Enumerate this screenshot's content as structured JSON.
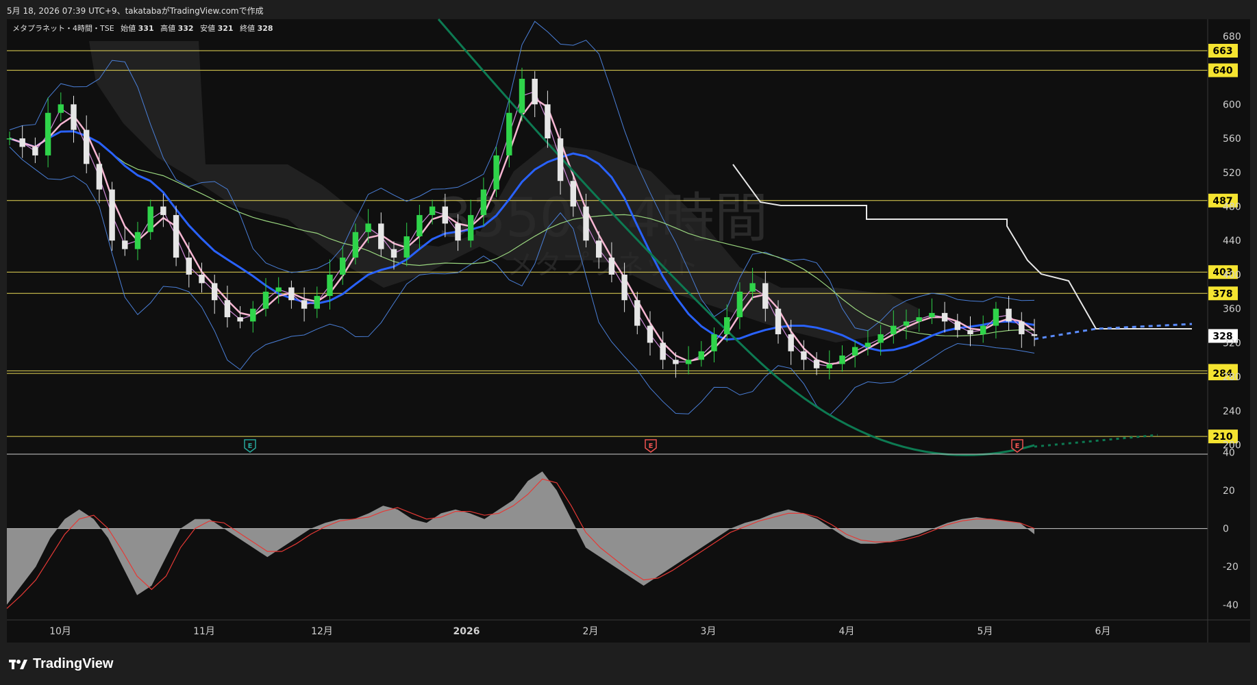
{
  "header": {
    "text": "5月 18, 2026 07:39 UTC+9、takatabaがTradingView.comで作成"
  },
  "legend": {
    "symbol": "メタプラネット・4時間・TSE",
    "open_label": "始値",
    "open": "331",
    "high_label": "高値",
    "high": "332",
    "low_label": "安値",
    "low": "321",
    "close_label": "終値",
    "close": "328"
  },
  "watermark": {
    "ticker": "3350、4時間",
    "name": "メタプラネット"
  },
  "footer": {
    "logo_text": "TradingView"
  },
  "colors": {
    "background": "#0f0f0f",
    "panel": "#1e1e1e",
    "level_line": "#e9d956",
    "level_badge": "#f5e430",
    "up": "#2fd44a",
    "down": "#e6e6e6",
    "ma_fast": "#f7b6d2",
    "ma_mid": "#d08ad8",
    "ma_slow": "#2962ff",
    "bollinger": "#4a7fd8",
    "long_ma": "#9ad67f",
    "trend": "#0d7a52",
    "lagging": "#e8e8e8",
    "macd_fill": "#9e9e9e",
    "macd_signal": "#e53935",
    "earnings_green": "#26a69a",
    "earnings_red": "#ef5350"
  },
  "icons": [
    "tradingview-logo-icon",
    "earnings-e-icon"
  ],
  "chart_data": [
    {
      "type": "candlestick",
      "title": "メタプラネット・4時間・TSE",
      "ylim": [
        190,
        700
      ],
      "y_ticks": [
        680,
        600,
        560,
        520,
        480,
        440,
        400,
        360,
        320,
        280,
        240,
        200
      ],
      "x_ticks": [
        "10月",
        "11月",
        "12月",
        "2026",
        "2月",
        "3月",
        "4月",
        "5月",
        "6月"
      ],
      "price_levels": [
        663,
        640,
        487,
        403,
        378,
        287,
        284,
        210
      ],
      "current_price": 328,
      "earnings_markers": [
        {
          "label": "E",
          "color": "green",
          "date": "12月"
        },
        {
          "label": "E",
          "color": "red",
          "date": "2月"
        },
        {
          "label": "E",
          "color": "red",
          "date": "5月"
        }
      ],
      "close_series": [
        560,
        550,
        540,
        590,
        600,
        570,
        530,
        500,
        440,
        430,
        450,
        480,
        470,
        420,
        400,
        390,
        370,
        350,
        345,
        360,
        380,
        385,
        370,
        360,
        375,
        400,
        420,
        450,
        460,
        430,
        420,
        445,
        470,
        480,
        460,
        440,
        470,
        500,
        540,
        590,
        630,
        600,
        560,
        510,
        480,
        440,
        420,
        400,
        370,
        340,
        320,
        300,
        295,
        300,
        310,
        330,
        350,
        380,
        390,
        360,
        330,
        310,
        300,
        290,
        295,
        305,
        315,
        320,
        330,
        340,
        345,
        350,
        355,
        345,
        335,
        330,
        340,
        360,
        345,
        330,
        328
      ]
    },
    {
      "type": "area",
      "title": "",
      "ylim": [
        -48,
        38
      ],
      "y_ticks": [
        40,
        20,
        0,
        -20,
        -40
      ],
      "series": [
        {
          "values": [
            -40,
            -30,
            -20,
            -5,
            5,
            10,
            5,
            -5,
            -20,
            -35,
            -30,
            -15,
            0,
            5,
            5,
            0,
            -5,
            -10,
            -15,
            -10,
            -5,
            0,
            3,
            5,
            5,
            8,
            12,
            10,
            5,
            3,
            8,
            10,
            8,
            5,
            10,
            15,
            25,
            30,
            20,
            5,
            -10,
            -15,
            -20,
            -25,
            -30,
            -25,
            -20,
            -15,
            -10,
            -5,
            0,
            3,
            5,
            8,
            10,
            8,
            5,
            0,
            -5,
            -8,
            -8,
            -7,
            -5,
            -3,
            0,
            3,
            5,
            6,
            5,
            4,
            3,
            -3
          ]
        },
        {
          "values": [
            -42,
            -35,
            -27,
            -15,
            -3,
            5,
            7,
            0,
            -12,
            -25,
            -32,
            -25,
            -10,
            0,
            4,
            3,
            -2,
            -7,
            -12,
            -12,
            -8,
            -3,
            1,
            4,
            5,
            6,
            9,
            11,
            8,
            5,
            6,
            9,
            9,
            7,
            8,
            12,
            18,
            26,
            24,
            12,
            -2,
            -10,
            -16,
            -22,
            -27,
            -26,
            -22,
            -17,
            -12,
            -7,
            -2,
            1,
            4,
            6,
            8,
            8,
            6,
            2,
            -3,
            -6,
            -7,
            -7,
            -6,
            -4,
            -1,
            2,
            4,
            5,
            5,
            4,
            3,
            0
          ]
        }
      ]
    }
  ]
}
